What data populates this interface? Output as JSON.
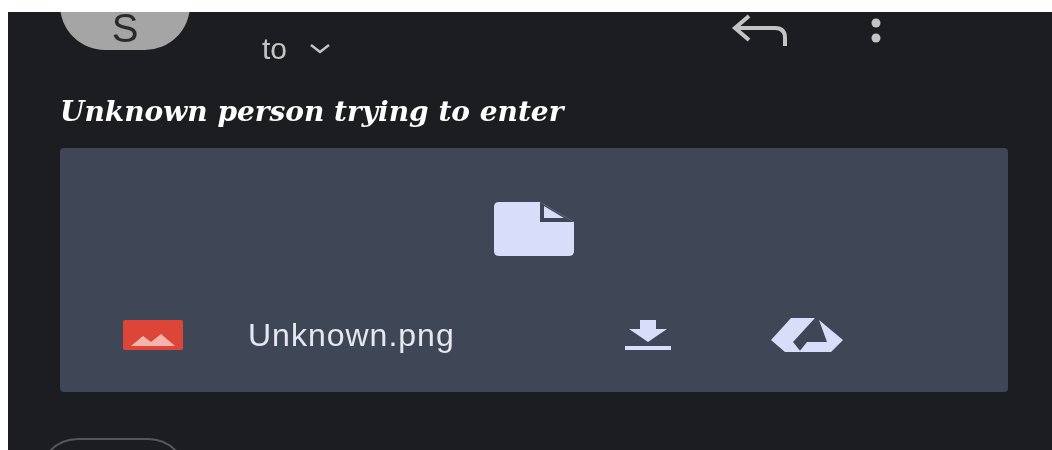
{
  "header": {
    "avatar_letter": "S",
    "recipient_label": "to"
  },
  "subject": "Unknown person trying to enter",
  "attachment": {
    "file_name": "Unknown.png"
  }
}
